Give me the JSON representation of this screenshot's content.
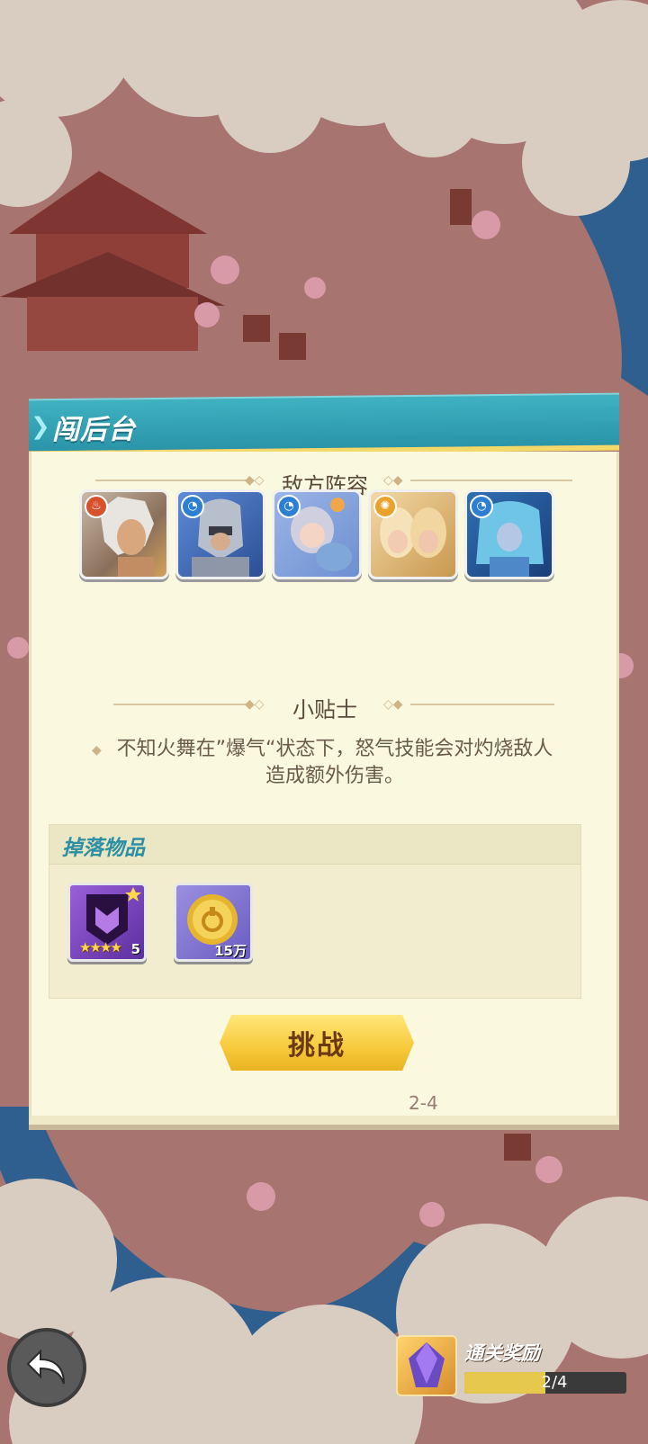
{
  "dialog": {
    "title": "闯后台",
    "enemy_section_title": "敌方阵容",
    "tip_section_title": "小贴士",
    "tip_text": "不知火舞在”爆气“状态下，怒气技能会对灼烧敌人造成额外伤害。",
    "drops_title": "掉落物品",
    "challenge_label": "挑战"
  },
  "enemies": [
    {
      "element_icon": "fire-element-icon",
      "element_color": "#d9512c",
      "portrait": "silver-haired-fighter"
    },
    {
      "element_icon": "water-element-icon",
      "element_color": "#2d7fd3",
      "portrait": "armored-knight"
    },
    {
      "element_icon": "water-element-icon",
      "element_color": "#2d7fd3",
      "portrait": "girl-with-shark-plush"
    },
    {
      "element_icon": "light-element-icon",
      "element_color": "#e9a22c",
      "portrait": "twin-blonde-heroes"
    },
    {
      "element_icon": "water-element-icon",
      "element_color": "#2d7fd3",
      "portrait": "blue-haired-maiden"
    }
  ],
  "drops": [
    {
      "icon": "purple-emblem-icon",
      "stars": 4,
      "quantity": "5"
    },
    {
      "icon": "gold-coin-icon",
      "quantity": "15万"
    }
  ],
  "stage_label": "2-4",
  "bottom": {
    "back_icon": "back-arrow-icon",
    "reward_label": "通关奖励",
    "reward_progress": "2/4",
    "reward_fraction": 0.5
  },
  "colors": {
    "header": "#3fb2c2",
    "panel": "#fbf8e0",
    "button": "#f7c93b",
    "accent_title": "#2c8fa3"
  }
}
